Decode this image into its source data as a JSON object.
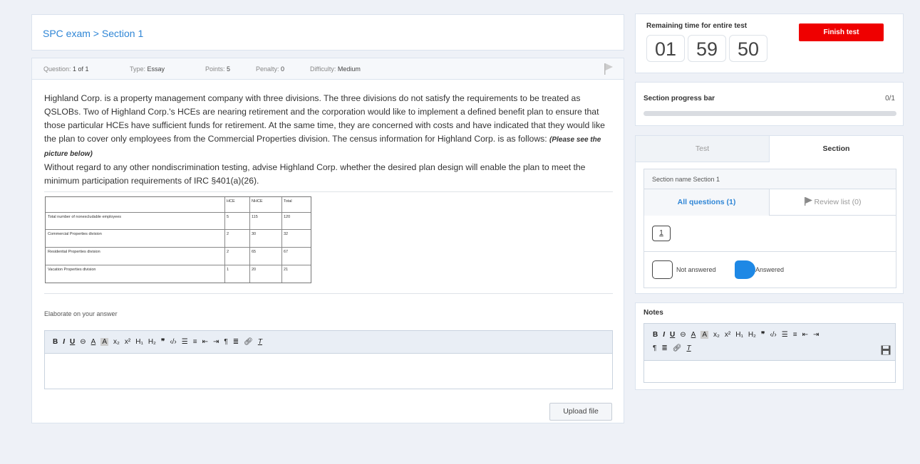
{
  "breadcrumb": "SPC exam > Section 1",
  "meta": [
    {
      "label": "Question:",
      "value": "1 of 1"
    },
    {
      "label": "Type:",
      "value": "Essay"
    },
    {
      "label": "Points:",
      "value": "5"
    },
    {
      "label": "Penalty:",
      "value": "0"
    },
    {
      "label": "Difficulty:",
      "value": "Medium"
    }
  ],
  "question": {
    "p1": "Highland Corp. is a property management company with three divisions. The three divisions do not satisfy the requirements to be treated as QSLOBs. Two of Highland Corp.'s HCEs are nearing retirement and the corporation would like to implement a defined benefit plan to ensure that those particular HCEs have sufficient funds for retirement. At the same time, they are concerned with costs and have indicated that they would like the plan to cover only employees from the Commercial Properties division. The census information for Highland Corp. is as follows:",
    "emph": "(Please see the picture below)",
    "p2": "Without regard to any other nondiscrimination testing, advise Highland Corp. whether the desired plan design will enable the plan to meet the minimum participation requirements of IRC §401(a)(26)."
  },
  "census": {
    "headers": [
      "",
      "HCE",
      "NHCE",
      "Total"
    ],
    "rows": [
      [
        "Total number of nonexcludable employees",
        "5",
        "115",
        "120"
      ],
      [
        "Commercial Properties division",
        "2",
        "30",
        "32"
      ],
      [
        "Residential Properties division",
        "2",
        "65",
        "67"
      ],
      [
        "Vacation Properties division",
        "1",
        "20",
        "21"
      ]
    ]
  },
  "answer": {
    "label": "Elaborate on your answer",
    "upload_label": "Upload file"
  },
  "toolbar": [
    "B",
    "I",
    "U",
    "S",
    "A",
    "A",
    "x₂",
    "x²",
    "H₁",
    "H₂",
    "99",
    "‹/›",
    "list-ordered",
    "list-bullet",
    "outdent",
    "indent",
    "rtl",
    "align",
    "link",
    "clear"
  ],
  "timer": {
    "label": "Remaining time for entire test",
    "hours": "01",
    "minutes": "59",
    "seconds": "50",
    "finish_label": "Finish test"
  },
  "progress": {
    "label": "Section progress bar",
    "count": "0/1",
    "fraction": 0
  },
  "nav": {
    "tab_test": "Test",
    "tab_section": "Section",
    "section_name": "Section name Section 1",
    "all_questions": "All questions (1)",
    "review_list": "Review list (0)",
    "question_numbers": [
      "1"
    ],
    "legend_not_answered": "Not answered",
    "legend_answered": "Answered"
  },
  "notes": {
    "label": "Notes"
  },
  "colors": {
    "accent": "#2f86d6",
    "danger": "#ef0000",
    "answered": "#1e88e5"
  }
}
